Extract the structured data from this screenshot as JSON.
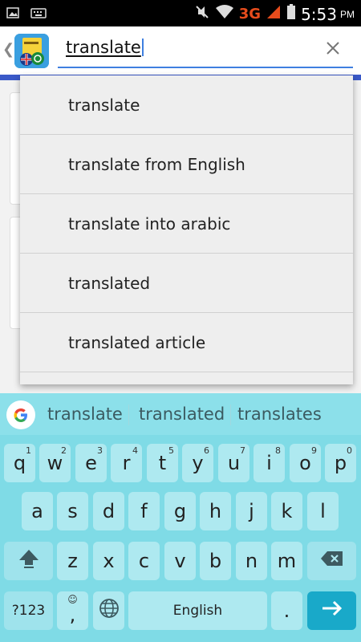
{
  "status_bar": {
    "network": "3G",
    "time": "5:53",
    "ampm": "PM"
  },
  "search": {
    "query": "translate"
  },
  "suggestions": [
    "translate",
    "translate from English",
    "translate into arabic",
    "translated",
    "translated article"
  ],
  "keyboard": {
    "word_suggestions": [
      "translate",
      "translated",
      "translates"
    ],
    "row1": [
      {
        "label": "q",
        "hint": "1"
      },
      {
        "label": "w",
        "hint": "2"
      },
      {
        "label": "e",
        "hint": "3"
      },
      {
        "label": "r",
        "hint": "4"
      },
      {
        "label": "t",
        "hint": "5"
      },
      {
        "label": "y",
        "hint": "6"
      },
      {
        "label": "u",
        "hint": "7"
      },
      {
        "label": "i",
        "hint": "8"
      },
      {
        "label": "o",
        "hint": "9"
      },
      {
        "label": "p",
        "hint": "0"
      }
    ],
    "row2": [
      "a",
      "s",
      "d",
      "f",
      "g",
      "h",
      "j",
      "k",
      "l"
    ],
    "row3": [
      "z",
      "x",
      "c",
      "v",
      "b",
      "n",
      "m"
    ],
    "symbols_label": "?123",
    "comma": ",",
    "space_label": "English",
    "period": "."
  },
  "colors": {
    "accent_blue": "#3a59c8",
    "keyboard_bg": "#7fdbe6",
    "enter_key": "#19a9c9",
    "network_3g": "#e74c1c"
  }
}
